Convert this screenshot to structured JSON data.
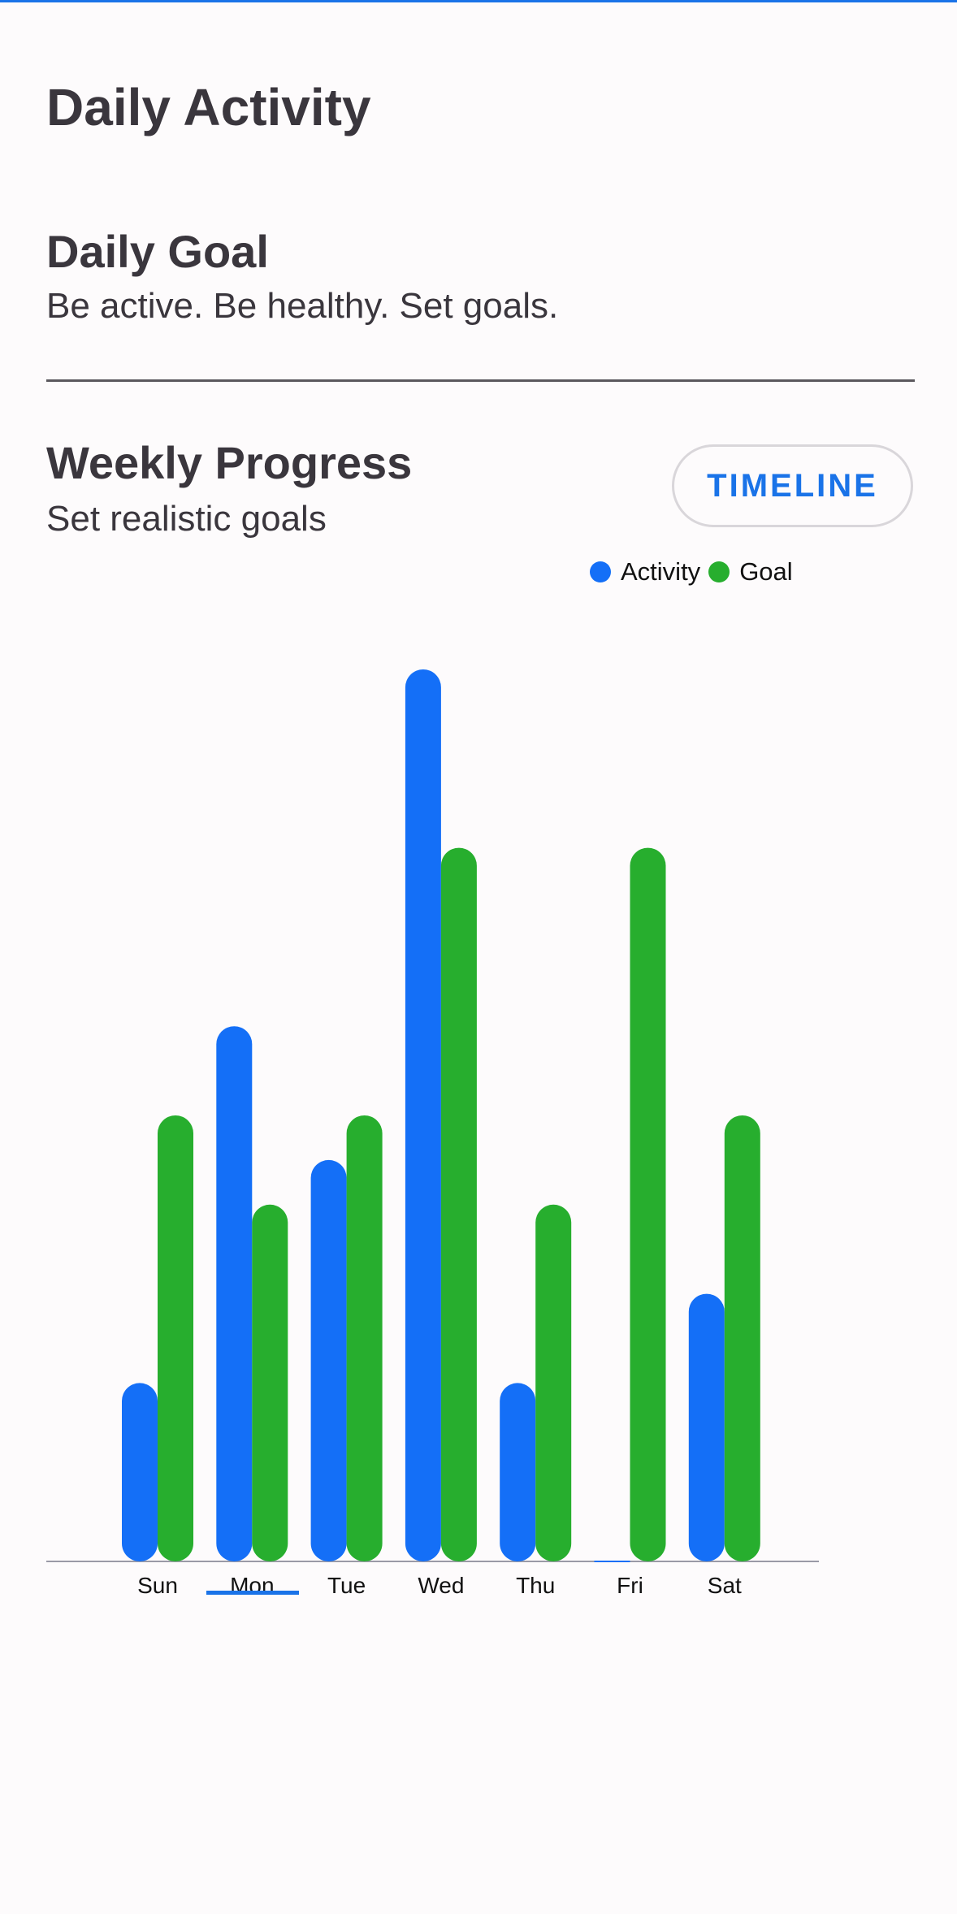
{
  "header": {
    "title": "Daily Activity"
  },
  "daily_goal": {
    "title": "Daily Goal",
    "subtitle": "Be active. Be healthy. Set goals."
  },
  "weekly_progress": {
    "title": "Weekly Progress",
    "subtitle": "Set realistic goals",
    "timeline_label": "TIMELINE"
  },
  "colors": {
    "accent": "#1a73e8",
    "activity": "#146ff7",
    "goal": "#27ae2e"
  },
  "selected_day": "Mon",
  "chart_data": {
    "type": "bar",
    "categories": [
      "Sun",
      "Mon",
      "Tue",
      "Wed",
      "Thu",
      "Fri",
      "Sat"
    ],
    "series": [
      {
        "name": "Activity",
        "values": [
          2,
          6,
          4.5,
          10,
          2,
          0,
          3
        ]
      },
      {
        "name": "Goal",
        "values": [
          5,
          4,
          5,
          8,
          4,
          8,
          5
        ]
      }
    ],
    "ylim": [
      0,
      10
    ],
    "legend": [
      "Activity",
      "Goal"
    ],
    "legend_position": "top-right",
    "grid": false
  }
}
